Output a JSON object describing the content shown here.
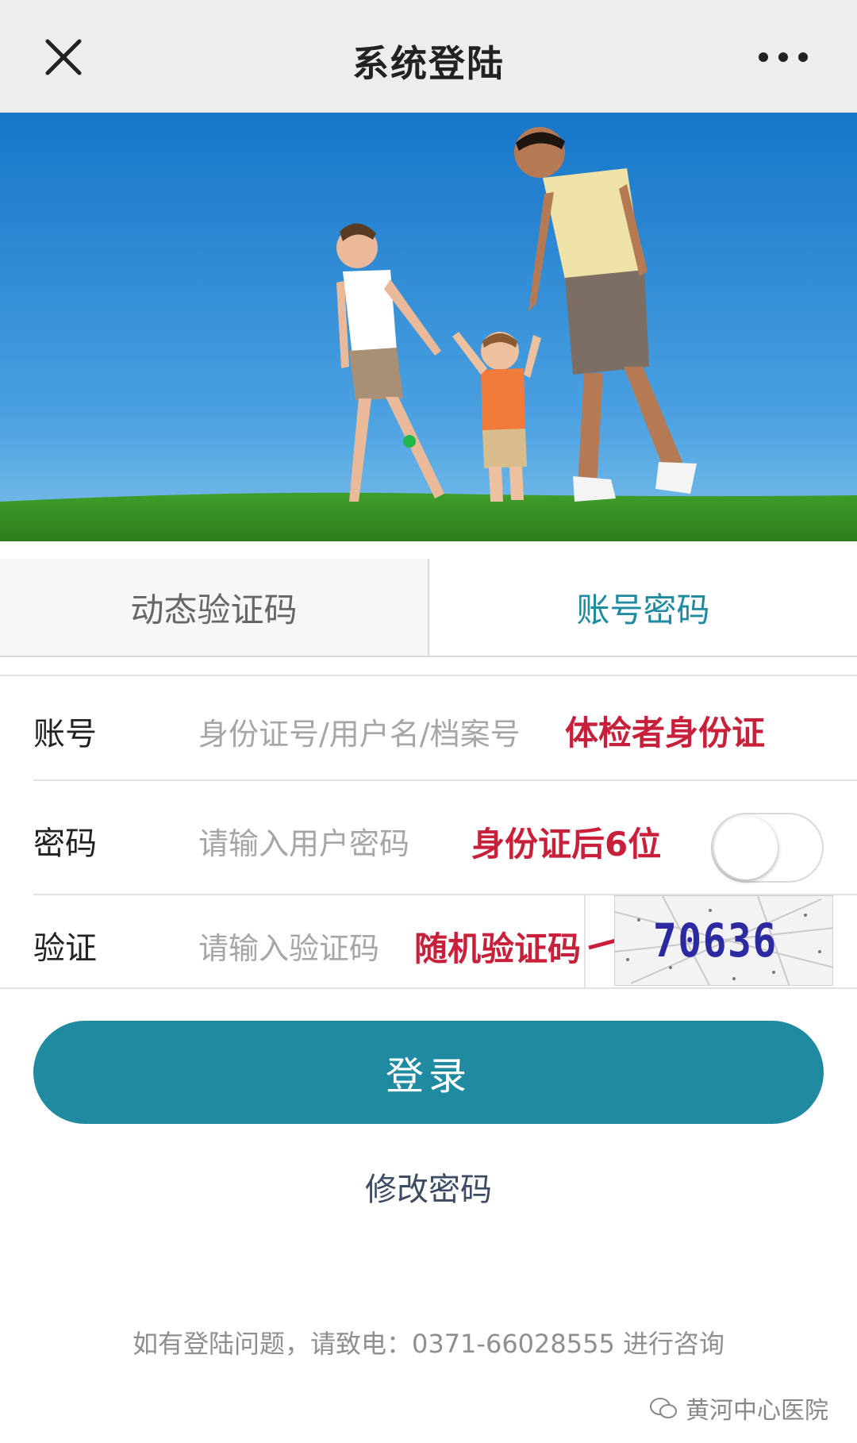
{
  "nav": {
    "title": "系统登陆",
    "close_icon": "close-icon",
    "more_icon": "more-icon"
  },
  "banner": {
    "description_icon": "family-photo"
  },
  "tabs": [
    {
      "label": "动态验证码",
      "active": false
    },
    {
      "label": "账号密码",
      "active": true
    }
  ],
  "form": {
    "account": {
      "label": "账号",
      "placeholder": "身份证号/用户名/档案号",
      "note": "体检者身份证"
    },
    "password": {
      "label": "密码",
      "placeholder": "请输入用户密码",
      "note": "身份证后6位",
      "toggle_on": false
    },
    "verify": {
      "label": "验证",
      "placeholder": "请输入验证码",
      "note": "随机验证码",
      "captcha": "70636"
    }
  },
  "login_label": "登录",
  "change_password_label": "修改密码",
  "help_text": "如有登陆问题，请致电：0371-66028555 进行咨询",
  "watermark": "黄河中心医院",
  "colors": {
    "accent": "#1f8aa0",
    "annotation_red": "#c8203a",
    "navbar": "#ededed"
  }
}
